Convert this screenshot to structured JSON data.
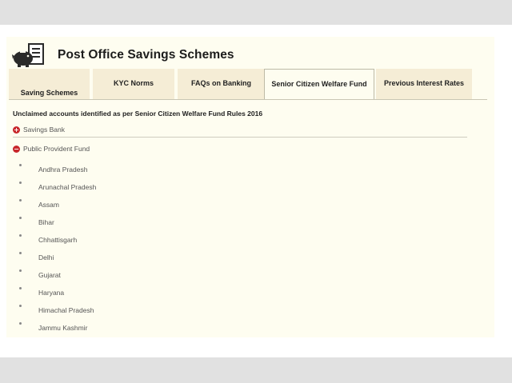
{
  "header": {
    "title": "Post Office Savings Schemes",
    "logo_icon": "piggy-bank-document-icon"
  },
  "tabs": [
    {
      "label": "Saving Schemes",
      "active": false
    },
    {
      "label": "KYC Norms",
      "active": false
    },
    {
      "label": "FAQs on Banking",
      "active": false
    },
    {
      "label": "Senior Citizen Welfare Fund",
      "active": true
    },
    {
      "label": "Previous Interest Rates",
      "active": false
    }
  ],
  "content": {
    "heading": "Unclaimed accounts identified as per Senior Citizen Welfare Fund Rules 2016",
    "accordions": [
      {
        "label": "Savings Bank",
        "icon": "plus-circle-icon",
        "expanded": false
      },
      {
        "label": "Public Provident Fund",
        "icon": "minus-circle-icon",
        "expanded": true
      }
    ],
    "states": [
      "Andhra Pradesh",
      "Arunachal Pradesh",
      "Assam",
      "Bihar",
      "Chhattisgarh",
      "Delhi",
      "Gujarat",
      "Haryana",
      "Himachal Pradesh",
      "Jammu Kashmir"
    ]
  },
  "colors": {
    "panel_bg": "#fefdf0",
    "tab_bg": "#f5edd6",
    "accent_red": "#c8262b"
  }
}
